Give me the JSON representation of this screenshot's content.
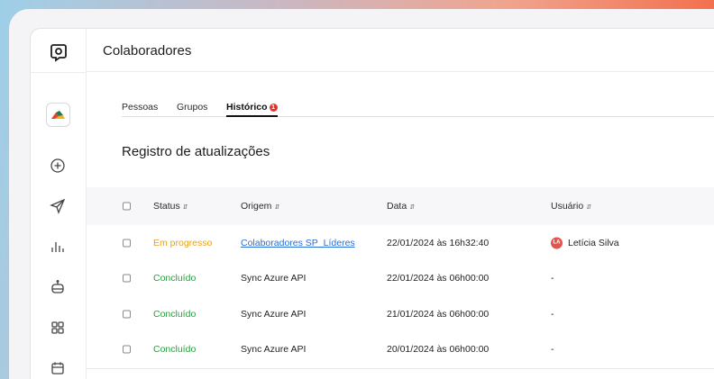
{
  "header": {
    "title": "Colaboradores"
  },
  "tabs": [
    {
      "label": "Pessoas"
    },
    {
      "label": "Grupos"
    },
    {
      "label": "Histórico",
      "badge": "1"
    }
  ],
  "section": {
    "title": "Registro de atualizações"
  },
  "table": {
    "columns": [
      "Status",
      "Origem",
      "Data",
      "Usuário"
    ],
    "rows": [
      {
        "status": "Em progresso",
        "origin": "Colaboradores SP_Líderes",
        "date": "22/01/2024 às 16h32:40",
        "user": "Letícia Silva",
        "initials": "LA"
      },
      {
        "status": "Concluído",
        "origin": "Sync Azure API",
        "date": "22/01/2024 às 06h00:00",
        "user": "-"
      },
      {
        "status": "Concluído",
        "origin": "Sync Azure API",
        "date": "21/01/2024 às 06h00:00",
        "user": "-"
      },
      {
        "status": "Concluído",
        "origin": "Sync Azure API",
        "date": "20/01/2024 às 06h00:00",
        "user": "-"
      }
    ]
  },
  "colors": {
    "in_progress": "#e8a21c",
    "done": "#2a9d3f",
    "link": "#2b6fd6",
    "badge": "#e5322d"
  },
  "icons": [
    "app-logo-icon",
    "brand-logo-icon",
    "add-circle-icon",
    "send-icon",
    "chart-bar-icon",
    "bot-icon",
    "grid-icon",
    "calendar-icon"
  ]
}
